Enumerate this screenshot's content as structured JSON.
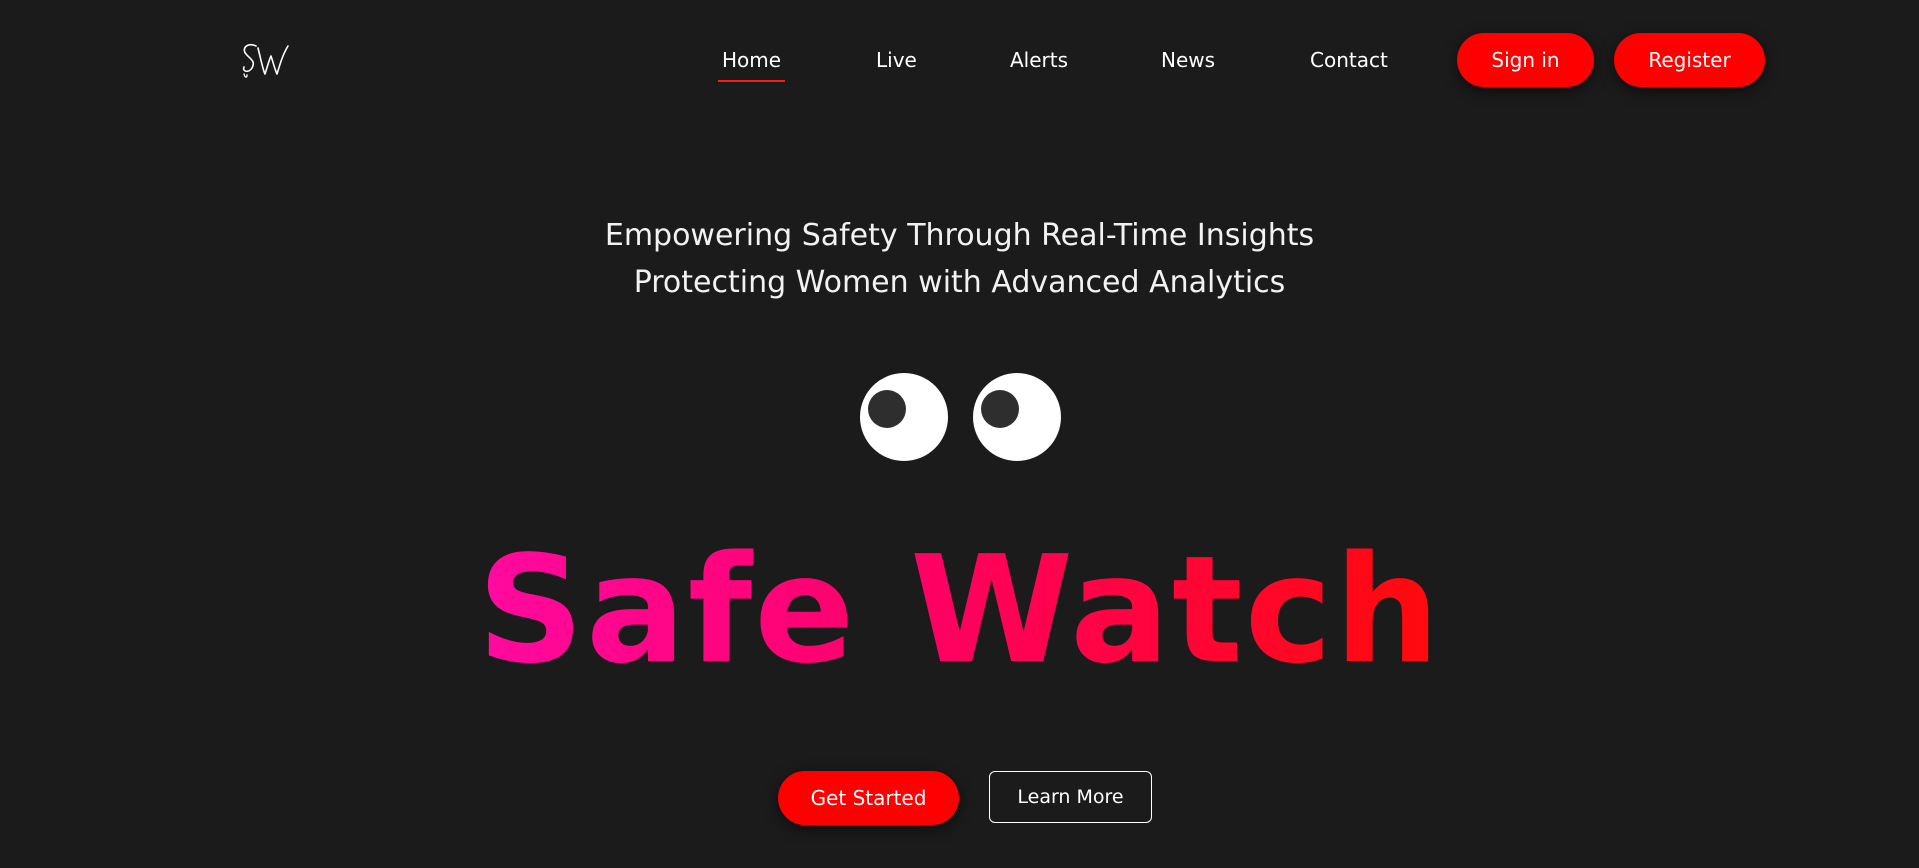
{
  "brand": {
    "logo_text": "SW",
    "name": "Safe Watch"
  },
  "nav": {
    "items": [
      {
        "label": "Home",
        "active": true
      },
      {
        "label": "Live",
        "active": false
      },
      {
        "label": "Alerts",
        "active": false
      },
      {
        "label": "News",
        "active": false
      },
      {
        "label": "Contact",
        "active": false
      }
    ],
    "sign_in_label": "Sign in",
    "register_label": "Register"
  },
  "hero": {
    "tagline_line1": "Empowering Safety Through Real-Time Insights",
    "tagline_line2": "Protecting Women with Advanced Analytics",
    "headline": "Safe Watch",
    "get_started_label": "Get Started",
    "learn_more_label": "Learn More"
  },
  "colors": {
    "background": "#1b1b1b",
    "accent_red": "#ff0000",
    "headline_gradient_start": "#ff0aa0",
    "headline_gradient_end": "#ff0a0a",
    "text": "#ffffff"
  }
}
